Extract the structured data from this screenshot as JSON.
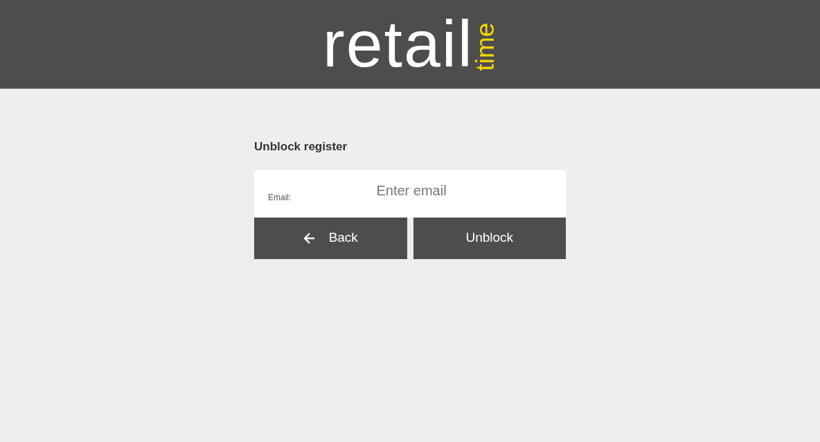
{
  "logo": {
    "main": "retail",
    "accent": "time"
  },
  "form": {
    "title": "Unblock register",
    "email_label": "Email:",
    "email_placeholder": "Enter email"
  },
  "buttons": [
    {
      "kind": "back",
      "label": "Back"
    },
    {
      "kind": "submit",
      "label": "Unblock"
    }
  ]
}
